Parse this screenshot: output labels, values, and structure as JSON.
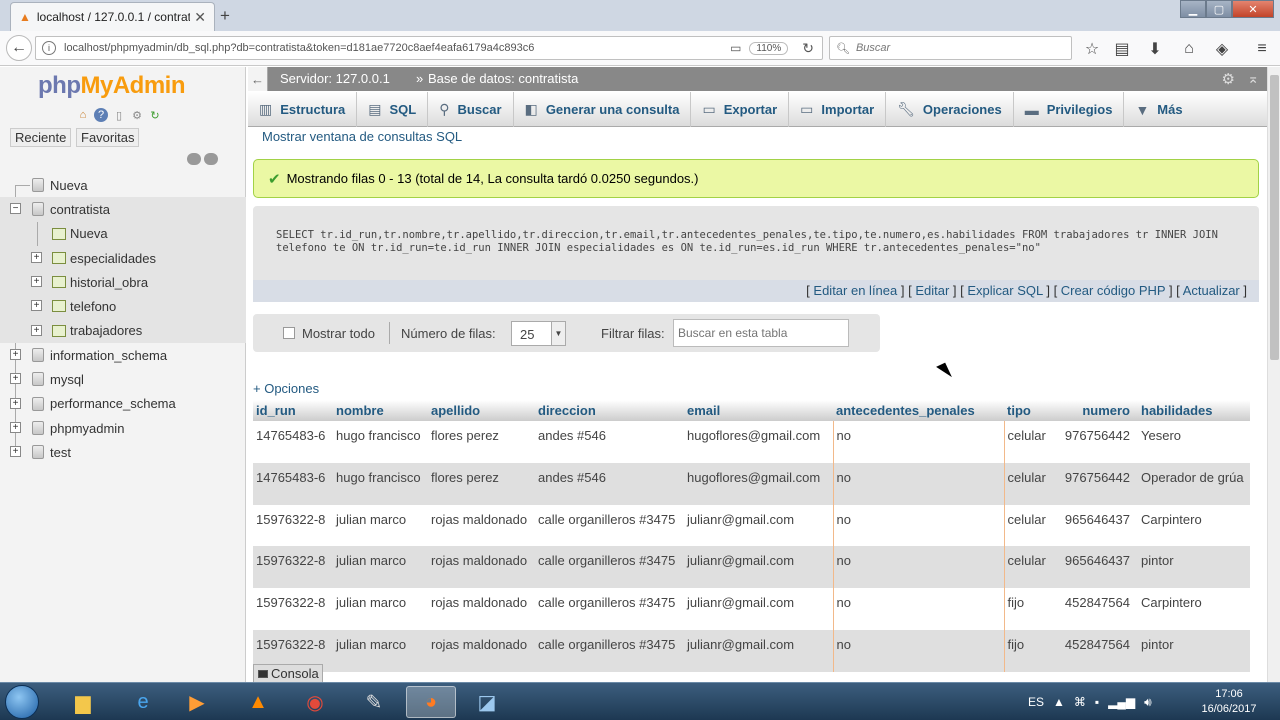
{
  "browser": {
    "tab_title": "localhost / 127.0.0.1 / contrat",
    "new_tab": "+",
    "url": "localhost/phpmyadmin/db_sql.php?db=contratista&token=d181ae7720c8aef4eafa6179a4c893c6",
    "zoom": "110%",
    "search_placeholder": "Buscar"
  },
  "leftnav": {
    "logo": {
      "php": "php",
      "my": "My",
      "admin": "Admin"
    },
    "tabs": [
      "Reciente",
      "Favoritas"
    ],
    "tree": [
      {
        "label": "Nueva"
      },
      {
        "label": "contratista"
      },
      {
        "label": "Nueva"
      },
      {
        "label": "especialidades"
      },
      {
        "label": "historial_obra"
      },
      {
        "label": "telefono"
      },
      {
        "label": "trabajadores"
      },
      {
        "label": "information_schema"
      },
      {
        "label": "mysql"
      },
      {
        "label": "performance_schema"
      },
      {
        "label": "phpmyadmin"
      },
      {
        "label": "test"
      }
    ]
  },
  "breadcrumb": {
    "server": "Servidor: 127.0.0.1",
    "separator": "»",
    "database": "Base de datos: contratista"
  },
  "menu": [
    {
      "label": "Estructura",
      "icon": "structure-icon"
    },
    {
      "label": "SQL",
      "icon": "sql-icon"
    },
    {
      "label": "Buscar",
      "icon": "search-icon"
    },
    {
      "label": "Generar una consulta",
      "icon": "query-icon"
    },
    {
      "label": "Exportar",
      "icon": "export-icon"
    },
    {
      "label": "Importar",
      "icon": "import-icon"
    },
    {
      "label": "Operaciones",
      "icon": "wrench-icon"
    },
    {
      "label": "Privilegios",
      "icon": "privileges-icon"
    },
    {
      "label": "Más",
      "icon": "chevron-down-icon"
    }
  ],
  "sql_window_link": "Mostrar ventana de consultas SQL",
  "success_message": "Mostrando filas 0 - 13 (total de 14, La consulta tardó 0.0250 segundos.)",
  "sql_query": "SELECT tr.id_run,tr.nombre,tr.apellido,tr.direccion,tr.email,tr.antecedentes_penales,te.tipo,te.numero,es.habilidades FROM trabajadores tr INNER JOIN telefono te ON tr.id_run=te.id_run INNER JOIN especialidades es ON te.id_run=es.id_run WHERE tr.antecedentes_penales=\"no\"",
  "sql_links": [
    "Editar en línea",
    "Editar",
    "Explicar SQL",
    "Crear código PHP",
    "Actualizar"
  ],
  "nav_table": {
    "show_all": "Mostrar todo",
    "rows_label": "Número de filas:",
    "rows_value": "25",
    "filter_label": "Filtrar filas:",
    "filter_placeholder": "Buscar en esta tabla"
  },
  "options_link": "+ Opciones",
  "results": {
    "columns": [
      "id_run",
      "nombre",
      "apellido",
      "direccion",
      "email",
      "antecedentes_penales",
      "tipo",
      "numero",
      "habilidades"
    ],
    "rows": [
      [
        "14765483-6",
        "hugo francisco",
        "flores perez",
        "andes #546",
        "hugoflores@gmail.com",
        "no",
        "celular",
        "976756442",
        "Yesero"
      ],
      [
        "14765483-6",
        "hugo francisco",
        "flores perez",
        "andes #546",
        "hugoflores@gmail.com",
        "no",
        "celular",
        "976756442",
        "Operador de grúa"
      ],
      [
        "15976322-8",
        "julian marco",
        "rojas maldonado",
        "calle organilleros #3475",
        "julianr@gmail.com",
        "no",
        "celular",
        "965646437",
        "Carpintero"
      ],
      [
        "15976322-8",
        "julian marco",
        "rojas maldonado",
        "calle organilleros #3475",
        "julianr@gmail.com",
        "no",
        "celular",
        "965646437",
        "pintor"
      ],
      [
        "15976322-8",
        "julian marco",
        "rojas maldonado",
        "calle organilleros #3475",
        "julianr@gmail.com",
        "no",
        "fijo",
        "452847564",
        "Carpintero"
      ],
      [
        "15976322-8",
        "julian marco",
        "rojas maldonado",
        "calle organilleros #3475",
        "julianr@gmail.com",
        "no",
        "fijo",
        "452847564",
        "pintor"
      ]
    ]
  },
  "console_label": "Consola",
  "taskbar": {
    "language": "ES",
    "time": "17:06",
    "date": "16/06/2017"
  }
}
